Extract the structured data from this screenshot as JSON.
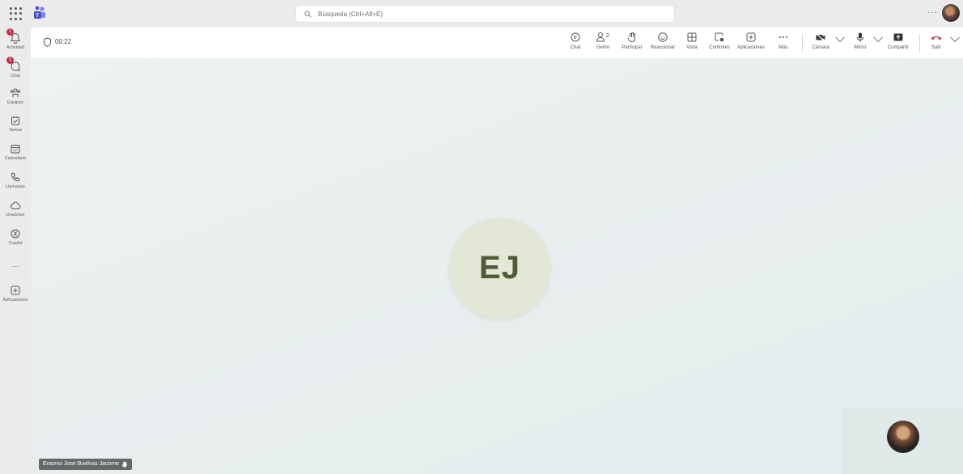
{
  "search": {
    "placeholder": "Búsqueda (Ctrl+Alt+E)"
  },
  "topbar": {
    "more": "···"
  },
  "rail": {
    "items": [
      {
        "label": "Actividad",
        "badge": "1",
        "icon": "bell-icon"
      },
      {
        "label": "Chat",
        "badge": "1",
        "icon": "chat-icon"
      },
      {
        "label": "Equipos",
        "icon": "teams-icon"
      },
      {
        "label": "Tareas",
        "icon": "tasks-icon"
      },
      {
        "label": "Calendario",
        "icon": "calendar-icon"
      },
      {
        "label": "Llamadas",
        "icon": "phone-icon"
      },
      {
        "label": "OneDrive",
        "icon": "cloud-icon"
      },
      {
        "label": "Copilot",
        "icon": "copilot-icon"
      },
      {
        "label": "···",
        "icon": "more-icon"
      },
      {
        "label": "Aplicaciones",
        "icon": "apps-icon"
      }
    ]
  },
  "meeting": {
    "timer": "00:22",
    "controls": {
      "chat": "Chat",
      "people": "Gente",
      "people_count": "2",
      "raise": "Participar",
      "react": "Reaccionar",
      "view": "Vista",
      "controls": "Controles",
      "apps": "Aplicaciones",
      "more": "Más",
      "camera": "Cámara",
      "mic": "Micro",
      "share": "Compartir",
      "leave": "Salir"
    },
    "leave_color": "#c4314b"
  },
  "participant": {
    "initials": "EJ",
    "name": "Erasmo Jose Buelvas Jacome"
  }
}
